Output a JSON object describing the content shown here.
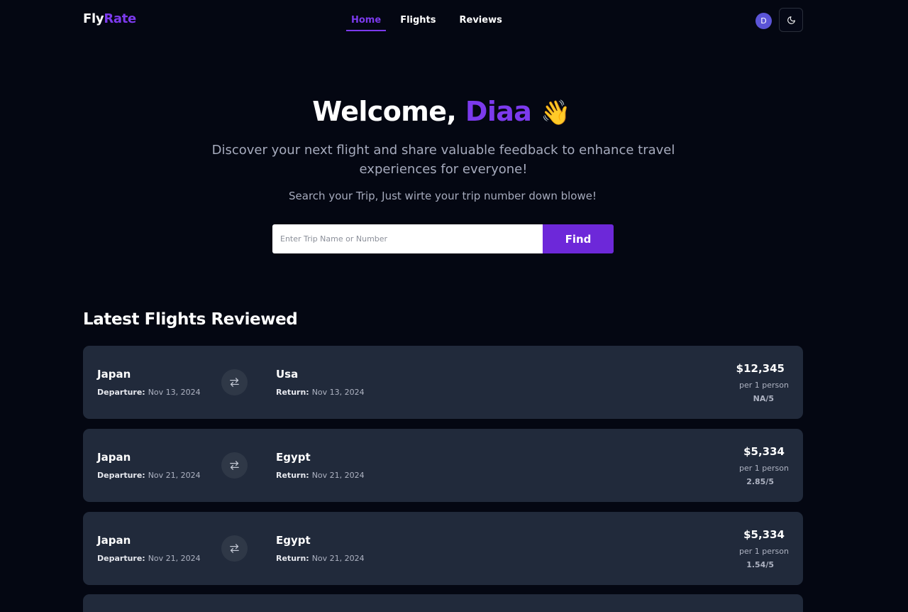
{
  "header": {
    "brand_part1": "Fly",
    "brand_part2": "Rate",
    "nav": [
      {
        "label": "Home",
        "active": true
      },
      {
        "label": "Flights",
        "active": false
      },
      {
        "label": "Reviews",
        "active": false
      }
    ],
    "avatar_initial": "D",
    "theme_icon": "moon-icon"
  },
  "hero": {
    "greeting": "Welcome,",
    "name": "Diaa",
    "emoji": "👋",
    "subtitle": "Discover your next flight and share valuable feedback to enhance travel experiences for everyone!",
    "hint": "Search your Trip, Just wirte your trip number down blowe!"
  },
  "search": {
    "placeholder": "Enter Trip Name or Number",
    "value": "",
    "button_label": "Find"
  },
  "latest": {
    "title": "Latest Flights Reviewed",
    "flights": [
      {
        "from": "Japan",
        "to": "Usa",
        "departure_label": "Departure:",
        "departure": "Nov 13, 2024",
        "return_label": "Return:",
        "return": "Nov 13, 2024",
        "price": "$12,345",
        "per": "per 1 person",
        "rating": "NA/5"
      },
      {
        "from": "Japan",
        "to": "Egypt",
        "departure_label": "Departure:",
        "departure": "Nov 21, 2024",
        "return_label": "Return:",
        "return": "Nov 21, 2024",
        "price": "$5,334",
        "per": "per 1 person",
        "rating": "2.85/5"
      },
      {
        "from": "Japan",
        "to": "Egypt",
        "departure_label": "Departure:",
        "departure": "Nov 21, 2024",
        "return_label": "Return:",
        "return": "Nov 21, 2024",
        "price": "$5,334",
        "per": "per 1 person",
        "rating": "1.54/5"
      }
    ]
  },
  "colors": {
    "background": "#040712",
    "accent": "#7c3aed",
    "card": "#212a3b",
    "muted_text": "#a6abbd"
  }
}
